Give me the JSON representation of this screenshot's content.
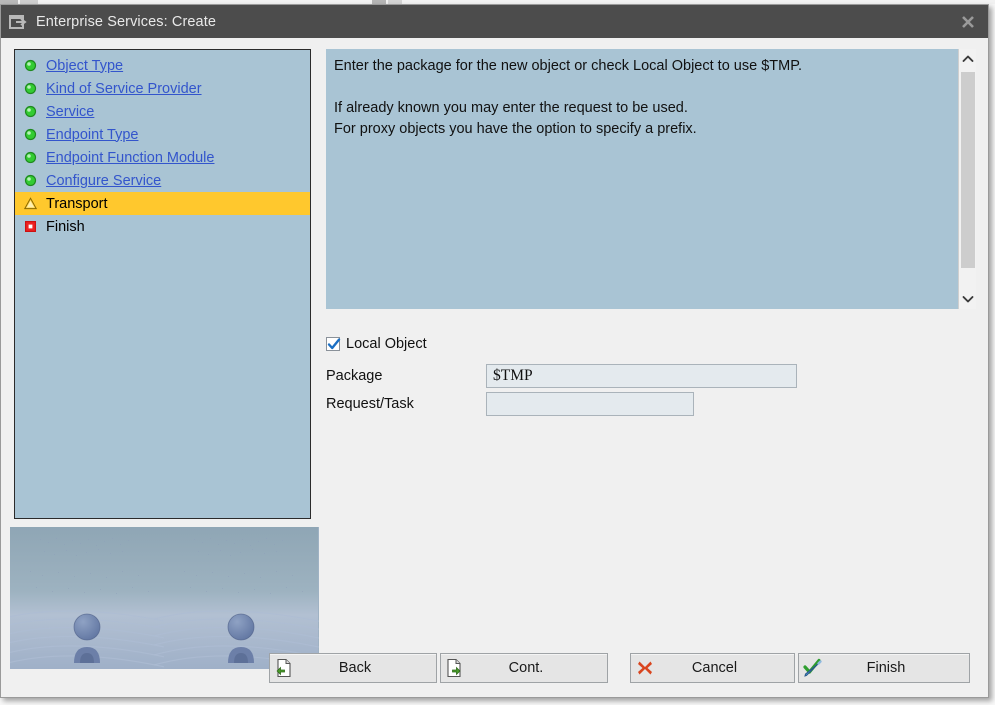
{
  "window": {
    "title": "Enterprise Services: Create",
    "title_icon": "dialog-window-icon",
    "close_icon": "close-icon"
  },
  "colors": {
    "titlebar": "#4c4c4c",
    "panel_blue": "#a9c4d4",
    "highlight_yellow": "#ffc82d",
    "link_blue": "#3355cc",
    "window_bg": "#f0f0f0",
    "input_bg": "#e4eaee",
    "status_green": "#2db52d",
    "status_yellow": "#ffcc33",
    "status_red": "#e02020"
  },
  "sidebar": {
    "items": [
      {
        "label": "Object Type",
        "status": "done",
        "status_icon": "green-sphere-icon",
        "is_link": true
      },
      {
        "label": "Kind of Service Provider",
        "status": "done",
        "status_icon": "green-sphere-icon",
        "is_link": true
      },
      {
        "label": "Service",
        "status": "done",
        "status_icon": "green-sphere-icon",
        "is_link": true
      },
      {
        "label": "Endpoint Type",
        "status": "done",
        "status_icon": "green-sphere-icon",
        "is_link": true
      },
      {
        "label": "Endpoint Function Module",
        "status": "done",
        "status_icon": "green-sphere-icon",
        "is_link": true
      },
      {
        "label": "Configure Service",
        "status": "done",
        "status_icon": "green-sphere-icon",
        "is_link": true
      },
      {
        "label": "Transport",
        "status": "current",
        "status_icon": "yellow-warning-triangle-icon",
        "is_link": false
      },
      {
        "label": "Finish",
        "status": "pending",
        "status_icon": "red-square-icon",
        "is_link": false
      }
    ],
    "decoration_icon": "wizard-decoration-graphic"
  },
  "description": {
    "text": "Enter the package for the new object or check Local Object to use $TMP.\n\nIf already known you may enter the request to be used.\nFor proxy objects you have the option to specify a prefix.",
    "scrollbar": {
      "up_icon": "chevron-up-icon",
      "down_icon": "chevron-down-icon"
    }
  },
  "form": {
    "local_object": {
      "label": "Local Object",
      "checked": true,
      "check_icon": "checkmark-icon"
    },
    "package": {
      "label": "Package",
      "value": "$TMP",
      "placeholder": ""
    },
    "request_task": {
      "label": "Request/Task",
      "value": "",
      "placeholder": ""
    }
  },
  "buttons": {
    "back": {
      "label": "Back",
      "icon": "page-back-icon"
    },
    "cont": {
      "label": "Cont.",
      "icon": "page-forward-icon"
    },
    "cancel": {
      "label": "Cancel",
      "icon": "red-x-icon"
    },
    "finish": {
      "label": "Finish",
      "icon": "check-pencil-icon"
    }
  }
}
